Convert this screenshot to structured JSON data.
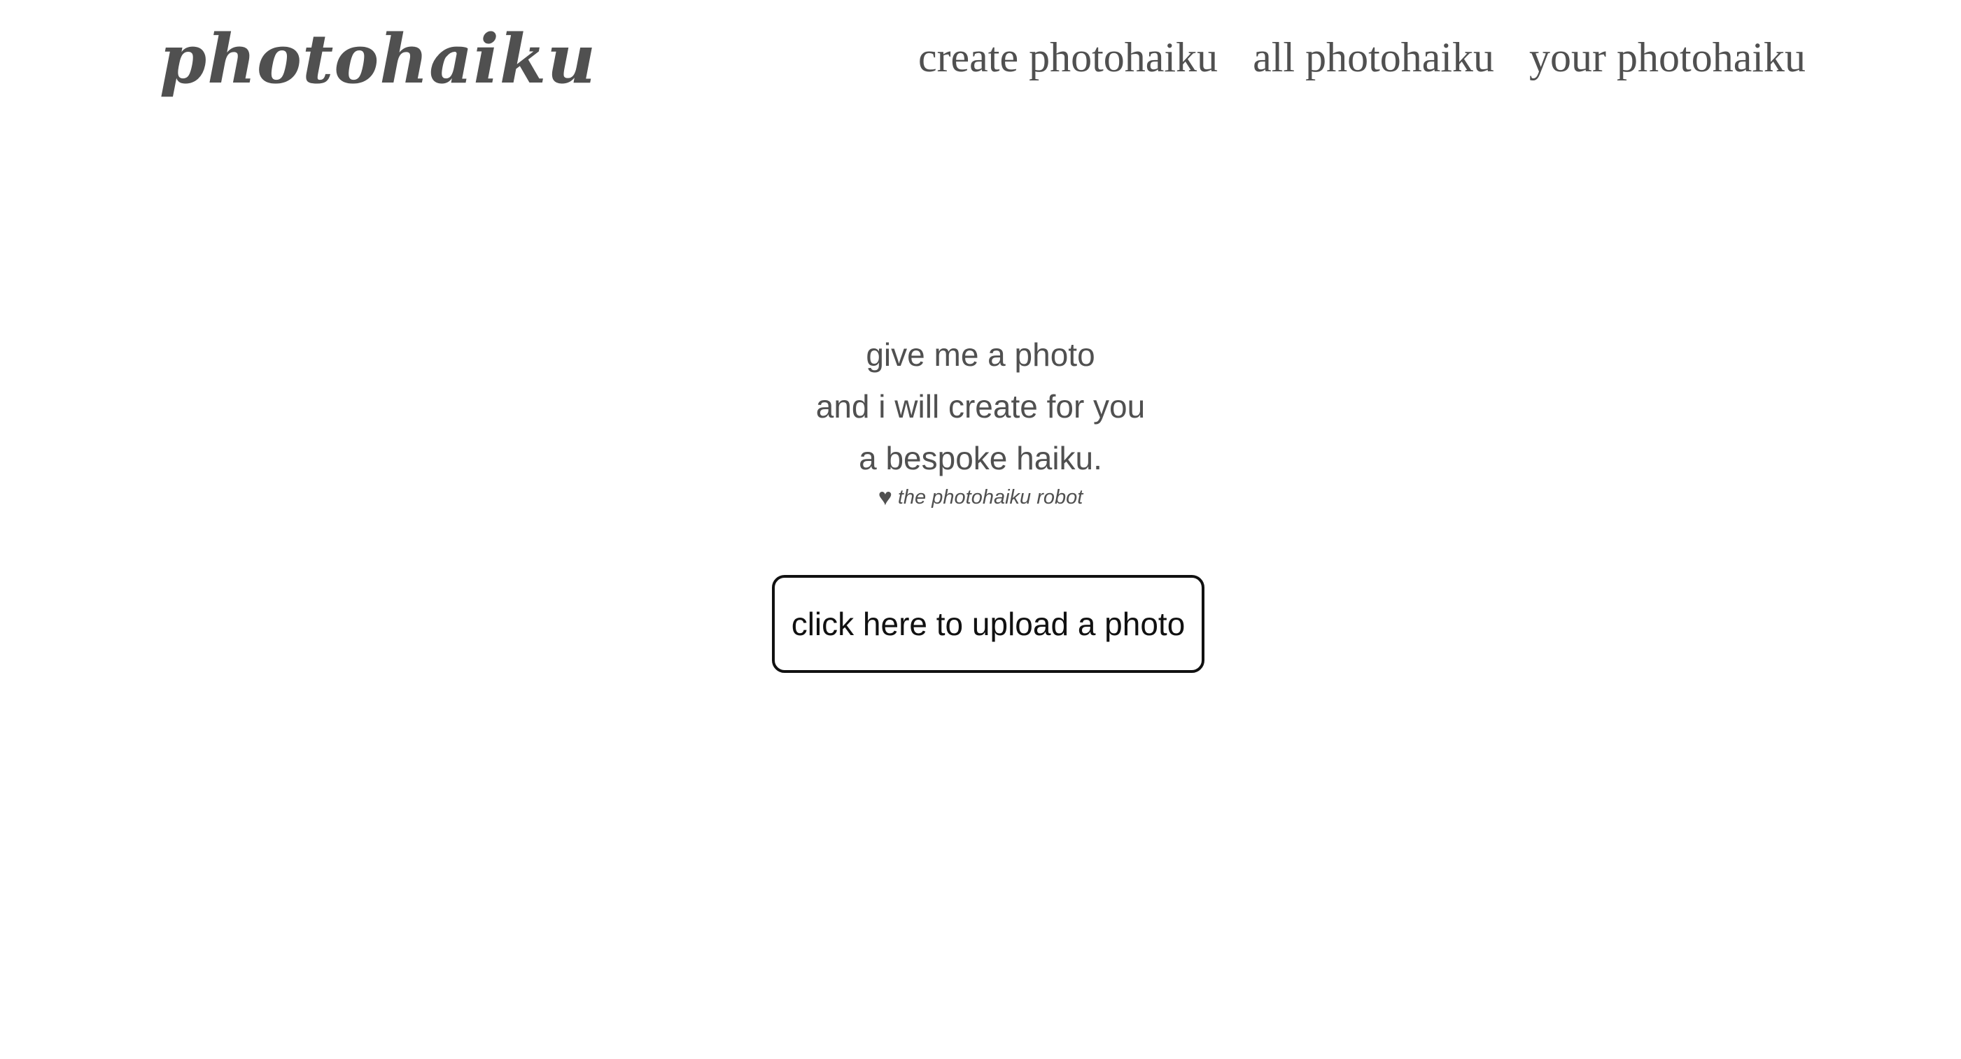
{
  "header": {
    "logo": "photohaiku",
    "nav": [
      {
        "label": "create photohaiku"
      },
      {
        "label": "all photohaiku"
      },
      {
        "label": "your photohaiku"
      }
    ]
  },
  "hero": {
    "lines": [
      "give me a photo",
      "and i will create for you",
      "a bespoke haiku."
    ],
    "signature_icon": "heart-icon",
    "signature": "the photohaiku robot"
  },
  "upload": {
    "label": "click here to upload a photo"
  },
  "colors": {
    "text": "#505050",
    "button_border": "#111111",
    "background": "#ffffff"
  }
}
